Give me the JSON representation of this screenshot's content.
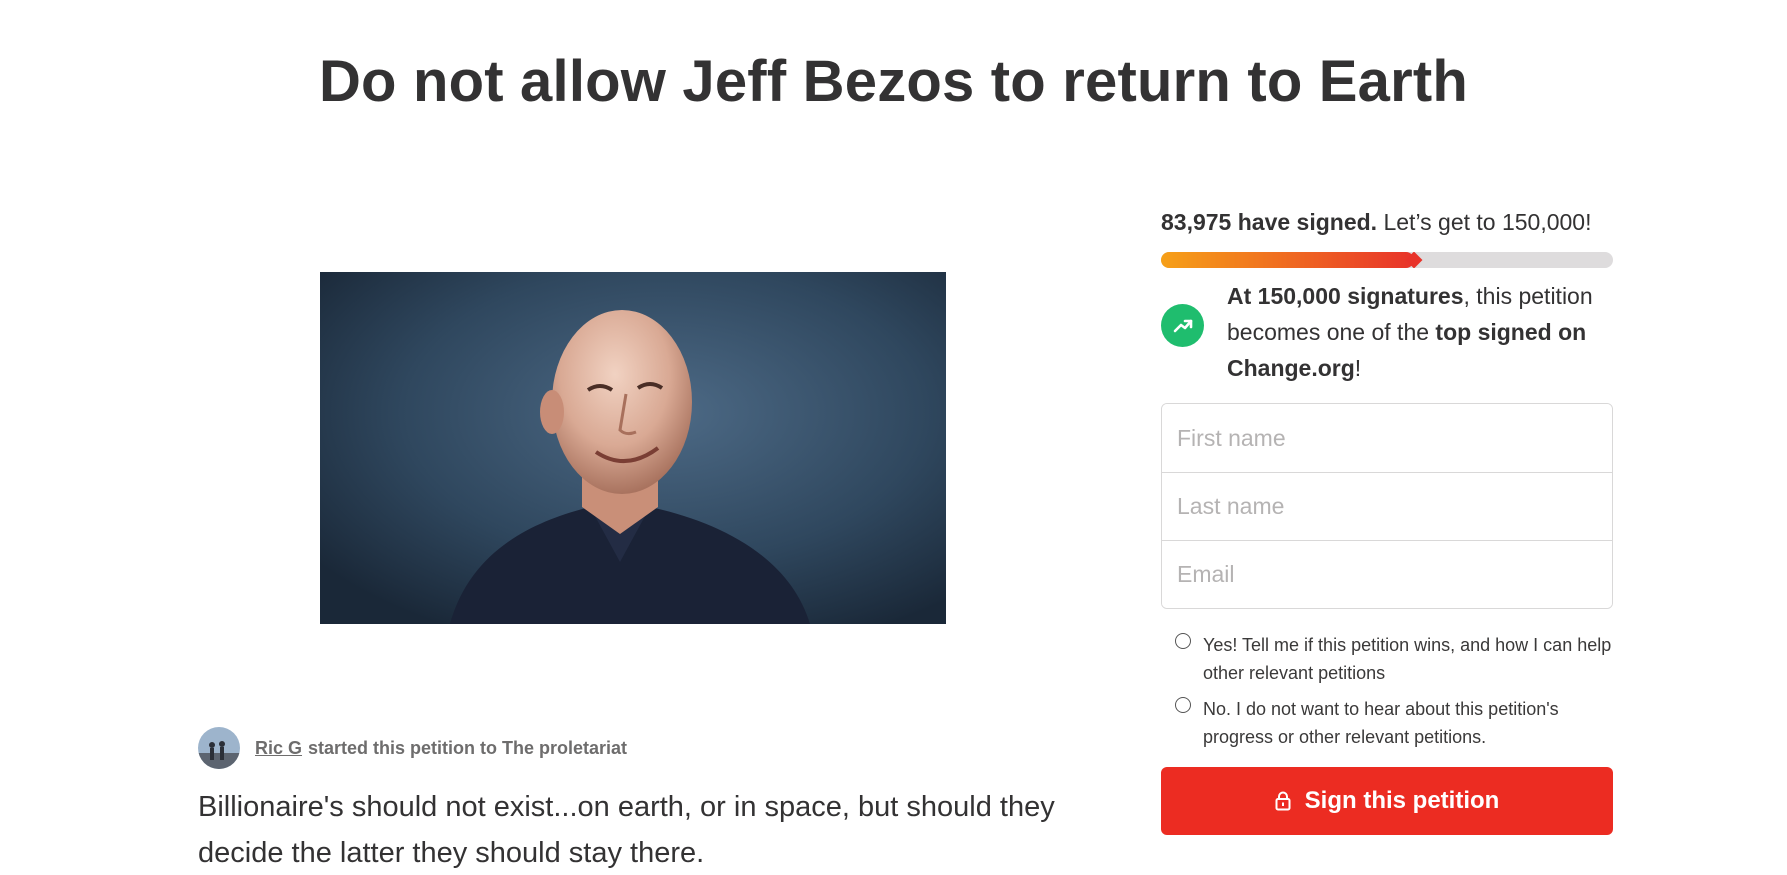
{
  "petition": {
    "title": "Do not allow Jeff Bezos to return to Earth",
    "starter_name": "Ric G",
    "starter_text": "started this petition to The proletariat",
    "description": "Billionaire's should not exist...on earth, or in space, but should they decide the latter they should stay there."
  },
  "signatures": {
    "count_bold": "83,975 have signed.",
    "goal_text": "Let’s get to 150,000!",
    "current": 83975,
    "goal": 150000,
    "progress_fraction": 0.56
  },
  "milestone": {
    "bold_1": "At 150,000 signatures",
    "text_1": ", this petition becomes one of the ",
    "bold_2": "top signed on Change.org",
    "text_2": "!",
    "icon": "trending-up-icon"
  },
  "form": {
    "first_name_placeholder": "First name",
    "last_name_placeholder": "Last name",
    "email_placeholder": "Email",
    "option_yes": "Yes! Tell me if this petition wins, and how I can help other relevant petitions",
    "option_no": "No. I do not want to hear about this petition's progress or other relevant petitions.",
    "submit_label": "Sign this petition"
  },
  "colors": {
    "accent_red": "#ec2c22",
    "milestone_green": "#1fbd6e",
    "progress_start": "#f6a018",
    "progress_end": "#e8332a"
  }
}
